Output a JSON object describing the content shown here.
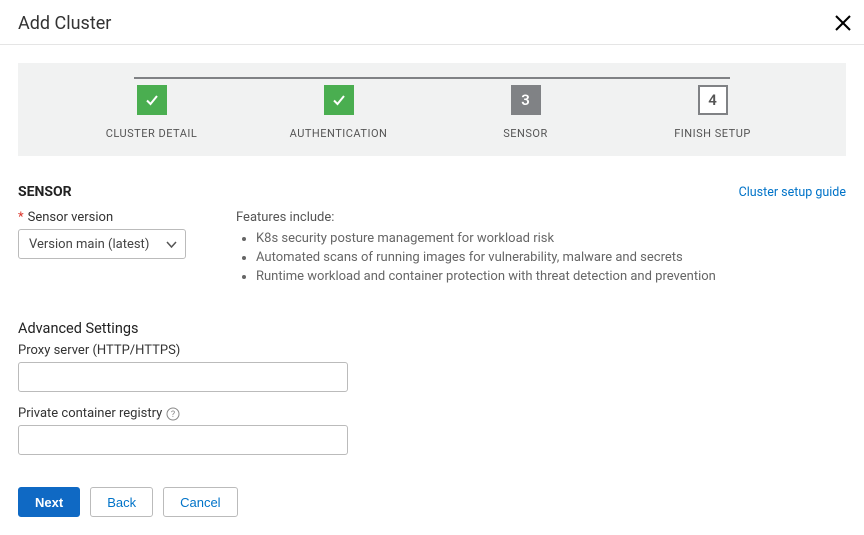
{
  "header": {
    "title": "Add Cluster"
  },
  "stepper": {
    "steps": [
      {
        "label": "CLUSTER DETAIL",
        "state": "done"
      },
      {
        "label": "AUTHENTICATION",
        "state": "done"
      },
      {
        "label": "SENSOR",
        "state": "current",
        "num": "3"
      },
      {
        "label": "FINISH SETUP",
        "state": "pending",
        "num": "4"
      }
    ]
  },
  "section": {
    "title": "SENSOR",
    "guide_link": "Cluster setup guide"
  },
  "sensor_version": {
    "label": "Sensor version",
    "selected": "Version main (latest)"
  },
  "features": {
    "heading": "Features include:",
    "items": [
      "K8s security posture management for workload risk",
      "Automated scans of running images for vulnerability, malware and secrets",
      "Runtime workload and container protection with threat detection and prevention"
    ]
  },
  "advanced": {
    "title": "Advanced Settings",
    "proxy": {
      "label": "Proxy server (HTTP/HTTPS)",
      "value": ""
    },
    "registry": {
      "label": "Private container registry",
      "value": ""
    }
  },
  "footer": {
    "next": "Next",
    "back": "Back",
    "cancel": "Cancel"
  }
}
